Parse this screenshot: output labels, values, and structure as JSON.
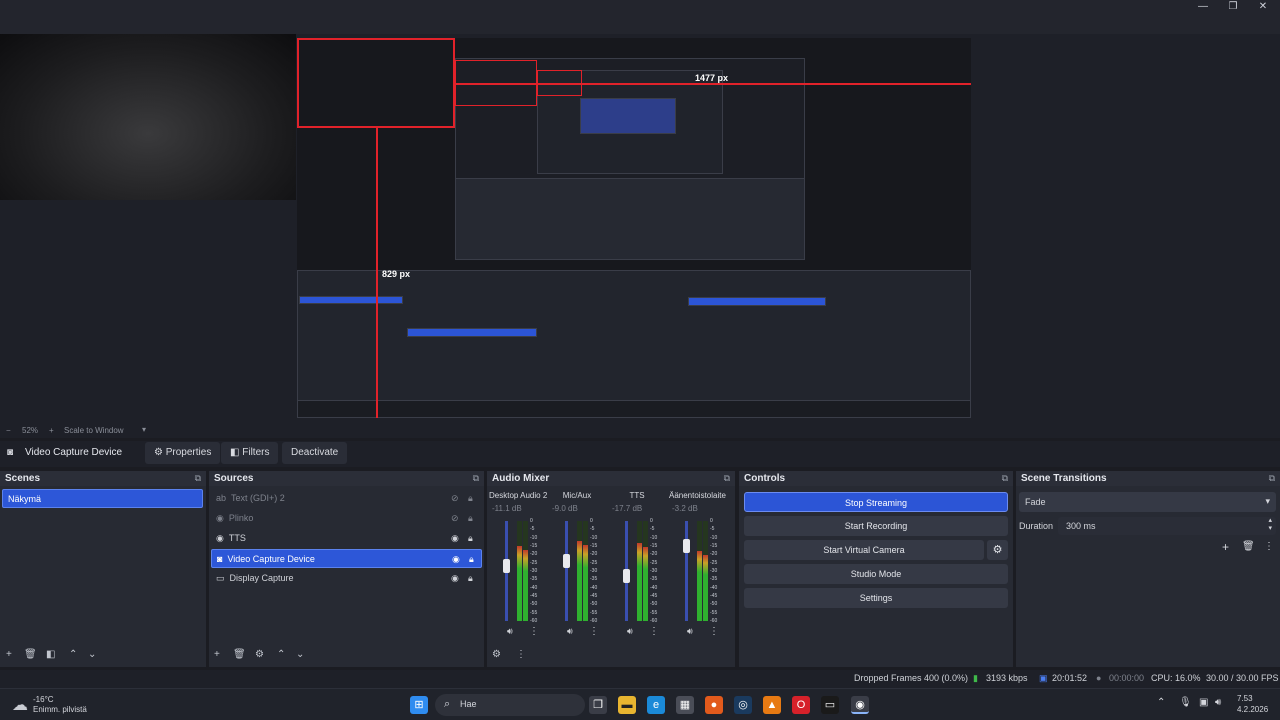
{
  "window": {
    "minimize_glyph": "—",
    "restore_glyph": "❐",
    "close_glyph": "✕"
  },
  "preview": {
    "width_label": "1477 px",
    "height_label": "829 px",
    "zoom_value": "52%",
    "scale_mode": "Scale to Window"
  },
  "source_toolbar": {
    "selected_source": "Video Capture Device",
    "properties_label": "Properties",
    "filters_label": "Filters",
    "deactivate_label": "Deactivate"
  },
  "scenes": {
    "title": "Scenes",
    "items": [
      "Näkymä"
    ]
  },
  "sources": {
    "title": "Sources",
    "items": [
      {
        "label": "Text (GDI+) 2",
        "visible": false
      },
      {
        "label": "Plinko",
        "visible": false
      },
      {
        "label": "TTS",
        "visible": true
      },
      {
        "label": "Video Capture Device",
        "visible": true,
        "selected": true
      },
      {
        "label": "Display Capture",
        "visible": true
      }
    ]
  },
  "audio_mixer": {
    "title": "Audio Mixer",
    "channels": [
      {
        "name": "Desktop Audio 2",
        "db": "-11.1 dB",
        "level": 0.75,
        "fader": 0.55
      },
      {
        "name": "Mic/Aux",
        "db": "-9.0 dB",
        "level": 0.8,
        "fader": 0.6
      },
      {
        "name": "TTS",
        "db": "-17.7 dB",
        "level": 0.78,
        "fader": 0.45
      },
      {
        "name": "Äänentoistolaite",
        "db": "-3.2 dB",
        "level": 0.7,
        "fader": 0.75
      }
    ],
    "scale": [
      "0",
      "-5",
      "-10",
      "-15",
      "-20",
      "-25",
      "-30",
      "-35",
      "-40",
      "-45",
      "-50",
      "-55",
      "-60"
    ]
  },
  "controls": {
    "title": "Controls",
    "stop_streaming": "Stop Streaming",
    "start_recording": "Start Recording",
    "start_virtual_camera": "Start Virtual Camera",
    "studio_mode": "Studio Mode",
    "settings": "Settings"
  },
  "scene_transitions": {
    "title": "Scene Transitions",
    "transition": "Fade",
    "duration_label": "Duration",
    "duration_value": "300 ms"
  },
  "status": {
    "dropped_frames": "Dropped Frames 400 (0.0%)",
    "bitrate": "3193 kbps",
    "stream_time": "20:01:52",
    "record_time": "00:00:00",
    "cpu": "CPU: 16.0%",
    "fps": "30.00 / 30.00 FPS"
  },
  "taskbar": {
    "weather_temp": "-16°C",
    "weather_desc": "Enimm. pilvistä",
    "search_placeholder": "Hae",
    "time": "7.53",
    "date": "4.2.2026"
  },
  "colors": {
    "accent": "#2c55d6",
    "red_guides": "#e1222a",
    "meter_green": "#2fb02f"
  }
}
